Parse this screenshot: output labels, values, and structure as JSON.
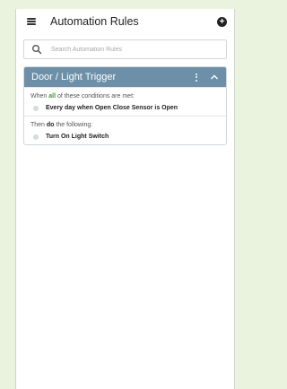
{
  "header": {
    "title": "Automation Rules"
  },
  "search": {
    "placeholder": "Search Automation Rules"
  },
  "rule": {
    "title": "Door / Light Trigger",
    "conditions_prefix": "When ",
    "conditions_keyword": "all",
    "conditions_suffix": " of these conditions are met:",
    "conditions": [
      "Every day when Open Close Sensor is Open"
    ],
    "actions_prefix": "Then ",
    "actions_keyword": "do",
    "actions_suffix": " the following:",
    "actions": [
      "Turn On Light Switch"
    ]
  },
  "colors": {
    "page_background": "#e9f3dd",
    "card_header": "#6d8fa8",
    "keyword_green": "#3c9a2c",
    "bullet": "#d3dbe4"
  },
  "icons": [
    "menu-icon",
    "add-circle-icon",
    "search-icon",
    "more-vert-icon",
    "chevron-up-icon"
  ]
}
